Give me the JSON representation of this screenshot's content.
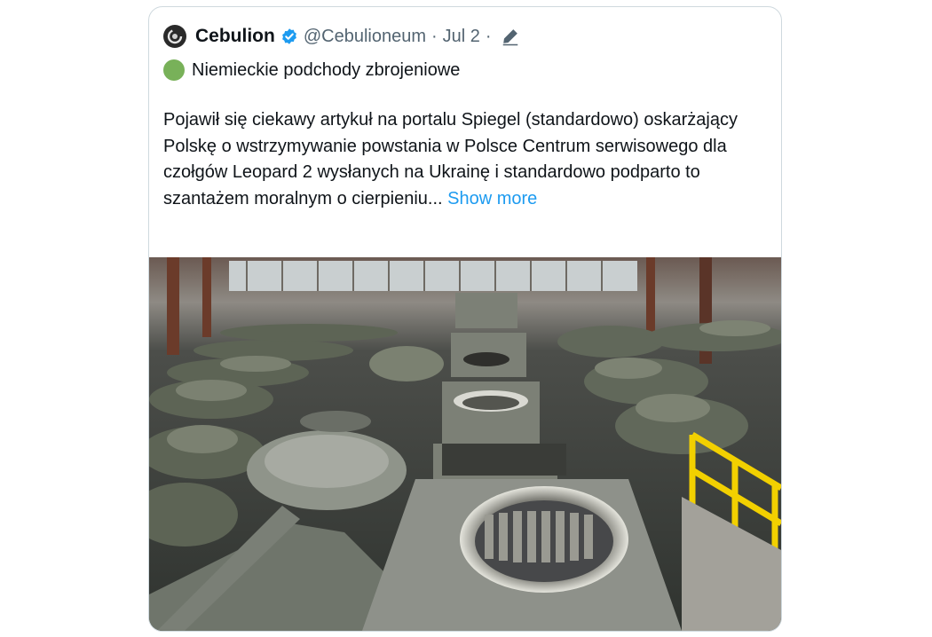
{
  "tweet": {
    "author_name": "Cebulion",
    "handle": "@Cebulioneum",
    "separator": "·",
    "date": "Jul 2",
    "subject_icon": "green-circle-emoji",
    "subject": "Niemieckie podchody zbrojeniowe",
    "body": "Pojawił się ciekawy artykuł na portalu Spiegel (standardowo) oskarżający Polskę o wstrzymywanie powstania w Polsce Centrum serwisowego dla czołgów Leopard 2 wysłanych na Ukrainę i standardowo podparto to szantażem moralnym o cierpieniu...",
    "show_more": "Show more"
  },
  "colors": {
    "link": "#1d9bf0",
    "verified": "#1d9bf0",
    "text": "#0f1419",
    "secondary": "#536471",
    "border": "#cfd9de",
    "emoji_green": "#78b159"
  }
}
